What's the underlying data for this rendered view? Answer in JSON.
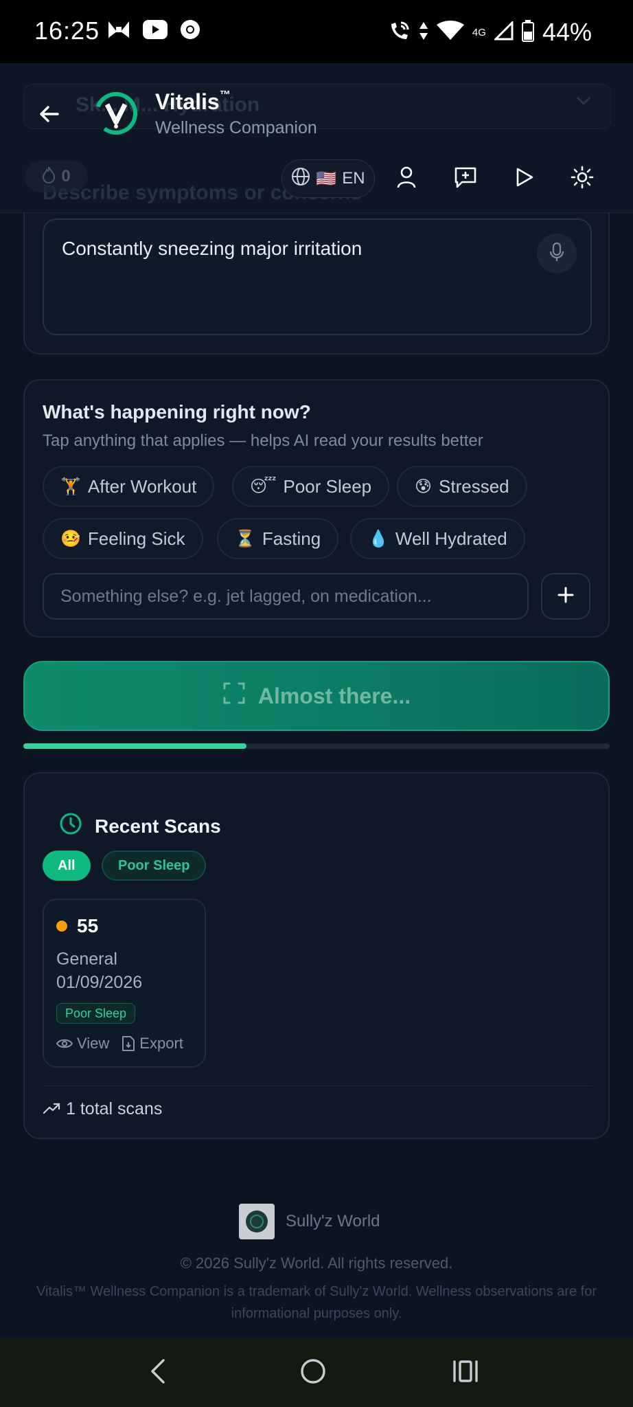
{
  "status_bar": {
    "time": "16:25",
    "network": "4G",
    "battery": "44%"
  },
  "header": {
    "ghost_select_text": "Sk... M... Hydration",
    "app_name": "Vitalis",
    "trademark": "™",
    "app_subtitle": "Wellness Companion",
    "streak_count": "0",
    "ghost_label": "Describe symptoms or concerns",
    "language_flag": "🇺🇸",
    "language_code": "EN"
  },
  "symptoms": {
    "value": "Constantly sneezing major irritation"
  },
  "context": {
    "title": "What's happening right now?",
    "subtitle": "Tap anything that applies — helps AI read your results better",
    "chips": [
      {
        "emoji": "🏋",
        "label": "After Workout"
      },
      {
        "emoji": "😴",
        "label": "Poor Sleep"
      },
      {
        "emoji": "😰",
        "label": "Stressed"
      },
      {
        "emoji": "🤒",
        "label": "Feeling Sick"
      },
      {
        "emoji": "⏳",
        "label": "Fasting"
      },
      {
        "emoji": "💧",
        "label": "Well Hydrated"
      }
    ],
    "other_placeholder": "Something else? e.g. jet lagged, on medication..."
  },
  "analyze": {
    "label": "Almost there...",
    "progress": 0.38
  },
  "recent_scans": {
    "title": "Recent Scans",
    "filters": [
      "All",
      "Poor Sleep"
    ],
    "items": [
      {
        "score": "55",
        "type": "General",
        "date": "01/09/2026",
        "tag": "Poor Sleep",
        "view_label": "View",
        "export_label": "Export"
      }
    ],
    "total_label": "1 total scans"
  },
  "footer": {
    "brand": "Sully'z World",
    "copyright": "© 2026 Sully'z World. All rights reserved.",
    "disclaimer": "Vitalis™ Wellness Companion is a trademark of Sully'z World. Wellness observations are for informational purposes only."
  },
  "colors": {
    "accent": "#10b981",
    "background": "#0c1422",
    "card": "#0e1827",
    "score_dot": "#f59e0b"
  }
}
